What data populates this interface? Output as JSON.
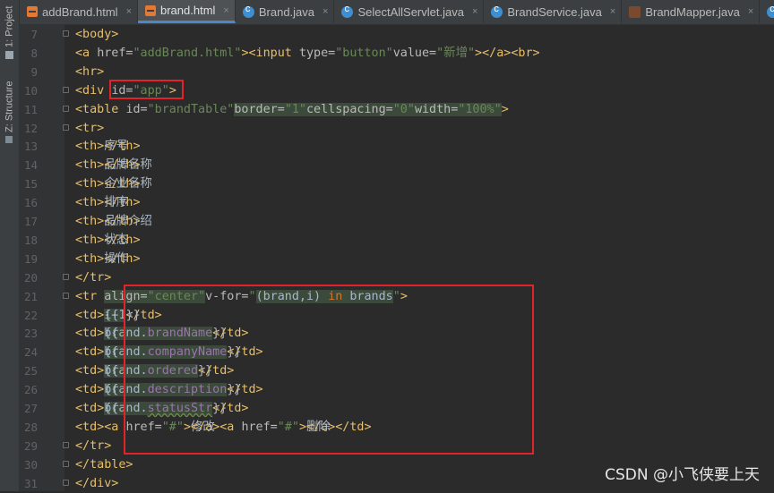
{
  "tool_windows": {
    "project": "1: Project",
    "structure": "Z: Structure"
  },
  "tabs": [
    {
      "label": "addBrand.html",
      "type": "html",
      "active": false
    },
    {
      "label": "brand.html",
      "type": "html",
      "active": true
    },
    {
      "label": "Brand.java",
      "type": "java",
      "active": false
    },
    {
      "label": "SelectAllServlet.java",
      "type": "java",
      "active": false
    },
    {
      "label": "BrandService.java",
      "type": "java",
      "active": false
    },
    {
      "label": "BrandMapper.java",
      "type": "mapper",
      "active": false
    },
    {
      "label": "05-",
      "type": "java",
      "active": false
    }
  ],
  "close_glyph": "×",
  "lines": [
    {
      "n": "7",
      "tokens": [
        [
          "tag",
          "<body>"
        ]
      ]
    },
    {
      "n": "8",
      "tokens": [
        [
          "tag",
          "<a "
        ],
        [
          "an",
          "href="
        ],
        [
          "av",
          "\"addBrand.html\""
        ],
        [
          "tag",
          "><input "
        ],
        [
          "an",
          "type="
        ],
        [
          "av",
          "\"button\""
        ],
        [
          "txt",
          " "
        ],
        [
          "an",
          "value="
        ],
        [
          "av",
          "\"新增\""
        ],
        [
          "tag",
          "></a><br>"
        ]
      ]
    },
    {
      "n": "9",
      "tokens": [
        [
          "tag",
          "<hr>"
        ]
      ]
    },
    {
      "n": "10",
      "tokens": [
        [
          "tag",
          "<div "
        ],
        [
          "an",
          "id="
        ],
        [
          "av",
          "\"app\""
        ],
        [
          "tag",
          ">"
        ]
      ]
    },
    {
      "n": "11",
      "tokens": [
        [
          "txt",
          "    "
        ],
        [
          "tag",
          "<table "
        ],
        [
          "an",
          "id="
        ],
        [
          "av",
          "\"brandTable\""
        ],
        [
          "txt",
          " "
        ],
        [
          "an hl",
          "border="
        ],
        [
          "av hl",
          "\"1\""
        ],
        [
          "txt",
          " "
        ],
        [
          "an hl",
          "cellspacing="
        ],
        [
          "av hl",
          "\"0\""
        ],
        [
          "txt",
          " "
        ],
        [
          "an hl",
          "width="
        ],
        [
          "av hl",
          "\"100%\""
        ],
        [
          "tag",
          ">"
        ]
      ]
    },
    {
      "n": "12",
      "tokens": [
        [
          "txt",
          "        "
        ],
        [
          "tag",
          "<tr>"
        ]
      ]
    },
    {
      "n": "13",
      "tokens": [
        [
          "txt",
          "            "
        ],
        [
          "tag",
          "<th>"
        ],
        [
          "txt",
          "序号"
        ],
        [
          "tag",
          "</th>"
        ]
      ]
    },
    {
      "n": "14",
      "tokens": [
        [
          "txt",
          "            "
        ],
        [
          "tag",
          "<th>"
        ],
        [
          "txt",
          "品牌名称"
        ],
        [
          "tag",
          "</th>"
        ]
      ]
    },
    {
      "n": "15",
      "tokens": [
        [
          "txt",
          "            "
        ],
        [
          "tag",
          "<th>"
        ],
        [
          "txt",
          "企业名称"
        ],
        [
          "tag",
          "</th>"
        ]
      ]
    },
    {
      "n": "16",
      "tokens": [
        [
          "txt",
          "            "
        ],
        [
          "tag",
          "<th>"
        ],
        [
          "txt",
          "排序"
        ],
        [
          "tag",
          "</th>"
        ]
      ]
    },
    {
      "n": "17",
      "tokens": [
        [
          "txt",
          "            "
        ],
        [
          "tag",
          "<th>"
        ],
        [
          "txt",
          "品牌介绍"
        ],
        [
          "tag",
          "</th>"
        ]
      ]
    },
    {
      "n": "18",
      "tokens": [
        [
          "txt",
          "            "
        ],
        [
          "tag",
          "<th>"
        ],
        [
          "txt",
          "状态"
        ],
        [
          "tag",
          "</th>"
        ]
      ]
    },
    {
      "n": "19",
      "tokens": [
        [
          "txt",
          "            "
        ],
        [
          "tag",
          "<th>"
        ],
        [
          "txt",
          "操作"
        ],
        [
          "tag",
          "</th>"
        ]
      ]
    },
    {
      "n": "20",
      "tokens": [
        [
          "txt",
          "        "
        ],
        [
          "tag",
          "</tr>"
        ]
      ]
    },
    {
      "n": "21",
      "tokens": [
        [
          "txt",
          "        "
        ],
        [
          "tag",
          "<tr "
        ],
        [
          "an hl",
          "align="
        ],
        [
          "av hl",
          "\"center\""
        ],
        [
          "txt",
          " "
        ],
        [
          "an",
          "v-for="
        ],
        [
          "av",
          "\""
        ],
        [
          "vm hl",
          "(brand,i) "
        ],
        [
          "kw hl",
          "in"
        ],
        [
          "vm hl",
          " brands"
        ],
        [
          "av",
          "\""
        ],
        [
          "tag",
          ">"
        ]
      ]
    },
    {
      "n": "22",
      "tokens": [
        [
          "txt",
          "            "
        ],
        [
          "tag",
          "<td>"
        ],
        [
          "txt",
          "{{"
        ],
        [
          "vm hl",
          "i+1"
        ],
        [
          "txt",
          "}}"
        ],
        [
          "tag",
          "</td>"
        ]
      ]
    },
    {
      "n": "23",
      "tokens": [
        [
          "txt",
          "            "
        ],
        [
          "tag",
          "<td>"
        ],
        [
          "txt",
          "{{"
        ],
        [
          "vm hl",
          "brand."
        ],
        [
          "pp hl",
          "brandName"
        ],
        [
          "txt",
          "}}"
        ],
        [
          "tag",
          "</td>"
        ]
      ]
    },
    {
      "n": "24",
      "tokens": [
        [
          "txt",
          "            "
        ],
        [
          "tag",
          "<td>"
        ],
        [
          "txt",
          "{{"
        ],
        [
          "vm hl",
          "brand."
        ],
        [
          "pp hl",
          "companyName"
        ],
        [
          "txt",
          "}}"
        ],
        [
          "tag",
          "</td>"
        ]
      ]
    },
    {
      "n": "25",
      "tokens": [
        [
          "txt",
          "            "
        ],
        [
          "tag",
          "<td>"
        ],
        [
          "txt",
          "{{"
        ],
        [
          "vm hl",
          "brand."
        ],
        [
          "pp hl",
          "ordered"
        ],
        [
          "txt",
          "}}"
        ],
        [
          "tag",
          "</td>"
        ]
      ]
    },
    {
      "n": "26",
      "tokens": [
        [
          "txt",
          "            "
        ],
        [
          "tag",
          "<td>"
        ],
        [
          "txt",
          "{{"
        ],
        [
          "vm hl",
          "brand."
        ],
        [
          "pp hl",
          "description"
        ],
        [
          "txt",
          "}}"
        ],
        [
          "tag",
          "</td>"
        ]
      ]
    },
    {
      "n": "27",
      "tokens": [
        [
          "txt",
          "            "
        ],
        [
          "tag",
          "<td>"
        ],
        [
          "txt",
          "{{"
        ],
        [
          "vm hl",
          "brand."
        ],
        [
          "pp hl wavy",
          "statusStr"
        ],
        [
          "txt",
          "}}"
        ],
        [
          "tag",
          "</td>"
        ]
      ]
    },
    {
      "n": "28",
      "tokens": [
        [
          "txt",
          "            "
        ],
        [
          "tag",
          "<td><a "
        ],
        [
          "an",
          "href="
        ],
        [
          "av",
          "\"#\""
        ],
        [
          "tag",
          ">"
        ],
        [
          "txt",
          "修改"
        ],
        [
          "tag",
          "</a>"
        ],
        [
          "txt",
          " "
        ],
        [
          "tag",
          "<a "
        ],
        [
          "an",
          "href="
        ],
        [
          "av",
          "\"#\""
        ],
        [
          "tag",
          ">"
        ],
        [
          "txt",
          "删除"
        ],
        [
          "tag",
          "</a></td>"
        ]
      ]
    },
    {
      "n": "29",
      "tokens": [
        [
          "txt",
          "        "
        ],
        [
          "tag",
          "</tr>"
        ]
      ]
    },
    {
      "n": "30",
      "tokens": [
        [
          "txt",
          "    "
        ],
        [
          "tag",
          "</table>"
        ]
      ]
    },
    {
      "n": "31",
      "tokens": [
        [
          "tag",
          "</div>"
        ]
      ]
    }
  ],
  "watermark": "CSDN @小飞侠要上天"
}
